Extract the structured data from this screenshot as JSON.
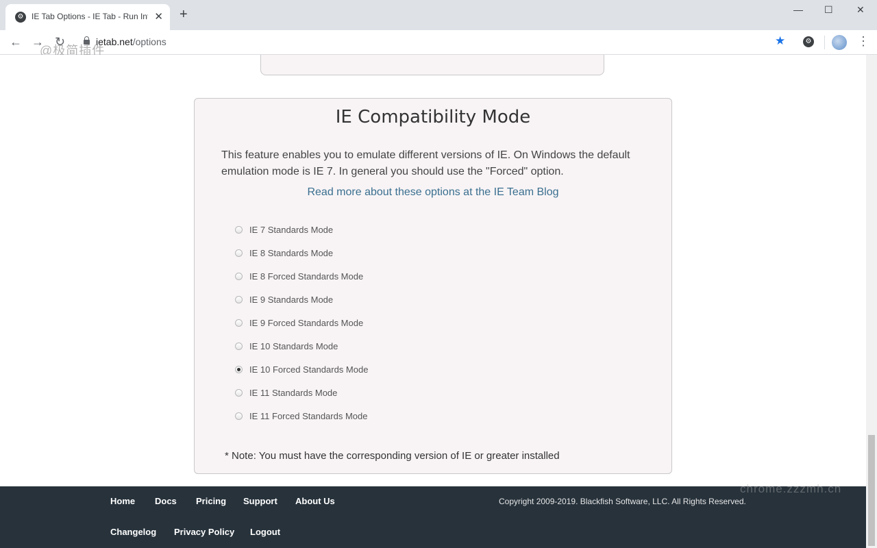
{
  "browser": {
    "tab_title": "IE Tab Options - IE Tab - Run Int...",
    "tab_favicon": "⚙",
    "tab_close": "✕",
    "new_tab": "+",
    "window_controls": {
      "minimize": "—",
      "maximize": "☐",
      "close": "✕"
    },
    "url_host": "ietab.net",
    "url_path": "/options",
    "watermark_top": "@极简插件",
    "nav_icons": {
      "back": "←",
      "forward": "→",
      "reload": "↻"
    }
  },
  "previous_card": {},
  "compat_card": {
    "title": "IE Compatibility Mode",
    "description": "This feature enables you to emulate different versions of IE. On Windows the default emulation mode is IE 7. In general you should use the \"Forced\" option.",
    "link": "Read more about these options at the IE Team Blog",
    "options": [
      {
        "label": "IE 7 Standards Mode",
        "checked": false
      },
      {
        "label": "IE 8 Standards Mode",
        "checked": false
      },
      {
        "label": "IE 8 Forced Standards Mode",
        "checked": false
      },
      {
        "label": "IE 9 Standards Mode",
        "checked": false
      },
      {
        "label": "IE 9 Forced Standards Mode",
        "checked": false
      },
      {
        "label": "IE 10 Standards Mode",
        "checked": false
      },
      {
        "label": "IE 10 Forced Standards Mode",
        "checked": true
      },
      {
        "label": "IE 11 Standards Mode",
        "checked": false
      },
      {
        "label": "IE 11 Forced Standards Mode",
        "checked": false
      }
    ],
    "note": "* Note: You must have the corresponding version of IE or greater installed"
  },
  "footer": {
    "links_row1": [
      "Home",
      "Docs",
      "Pricing",
      "Support",
      "About Us"
    ],
    "links_row2": [
      "Changelog",
      "Privacy Policy",
      "Logout"
    ],
    "copyright": "Copyright 2009-2019. Blackfish Software, LLC. All Rights Reserved.",
    "watermark": "chrome.zzzmh.cn"
  },
  "colors": {
    "footer_bg": "#27323b",
    "card_bg": "#f8f4f6",
    "link": "#3a6f8f",
    "star": "#1a73e8"
  }
}
